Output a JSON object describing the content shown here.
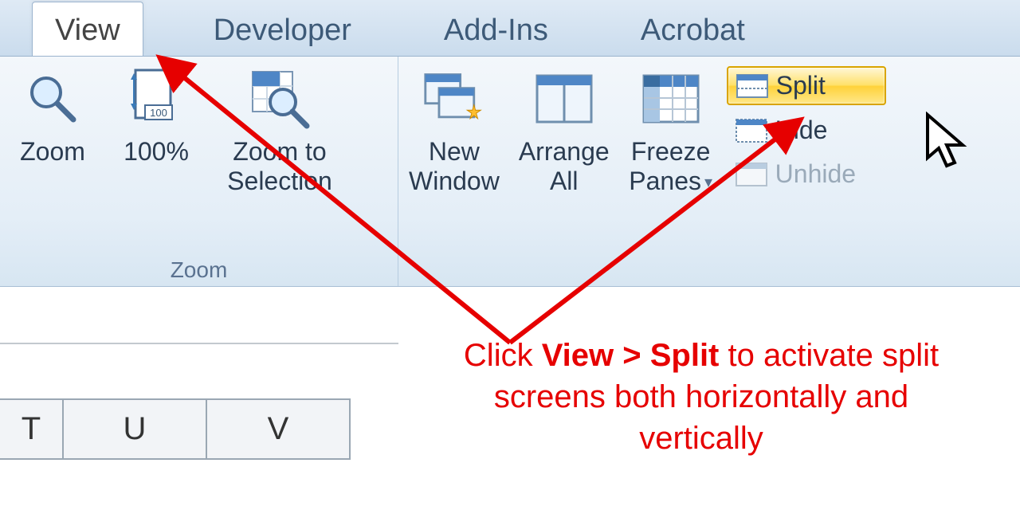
{
  "tabs": {
    "active": "View",
    "items": [
      "View",
      "Developer",
      "Add-Ins",
      "Acrobat"
    ]
  },
  "ribbon": {
    "zoom_group": {
      "label": "Zoom",
      "zoom": "Zoom",
      "pct100": "100%",
      "zoom_selection_l1": "Zoom to",
      "zoom_selection_l2": "Selection"
    },
    "window_group": {
      "new_window_l1": "New",
      "new_window_l2": "Window",
      "arrange_l1": "Arrange",
      "arrange_l2": "All",
      "freeze_l1": "Freeze",
      "freeze_l2": "Panes",
      "split": "Split",
      "hide": "Hide",
      "unhide": "Unhide"
    }
  },
  "columns": [
    "T",
    "U",
    "V"
  ],
  "instruction": {
    "pre": "Click ",
    "bold": "View > Split",
    "post": " to activate split screens both horizontally and vertically"
  },
  "colors": {
    "annotation": "#e60000",
    "highlight_border": "#d9a400"
  }
}
